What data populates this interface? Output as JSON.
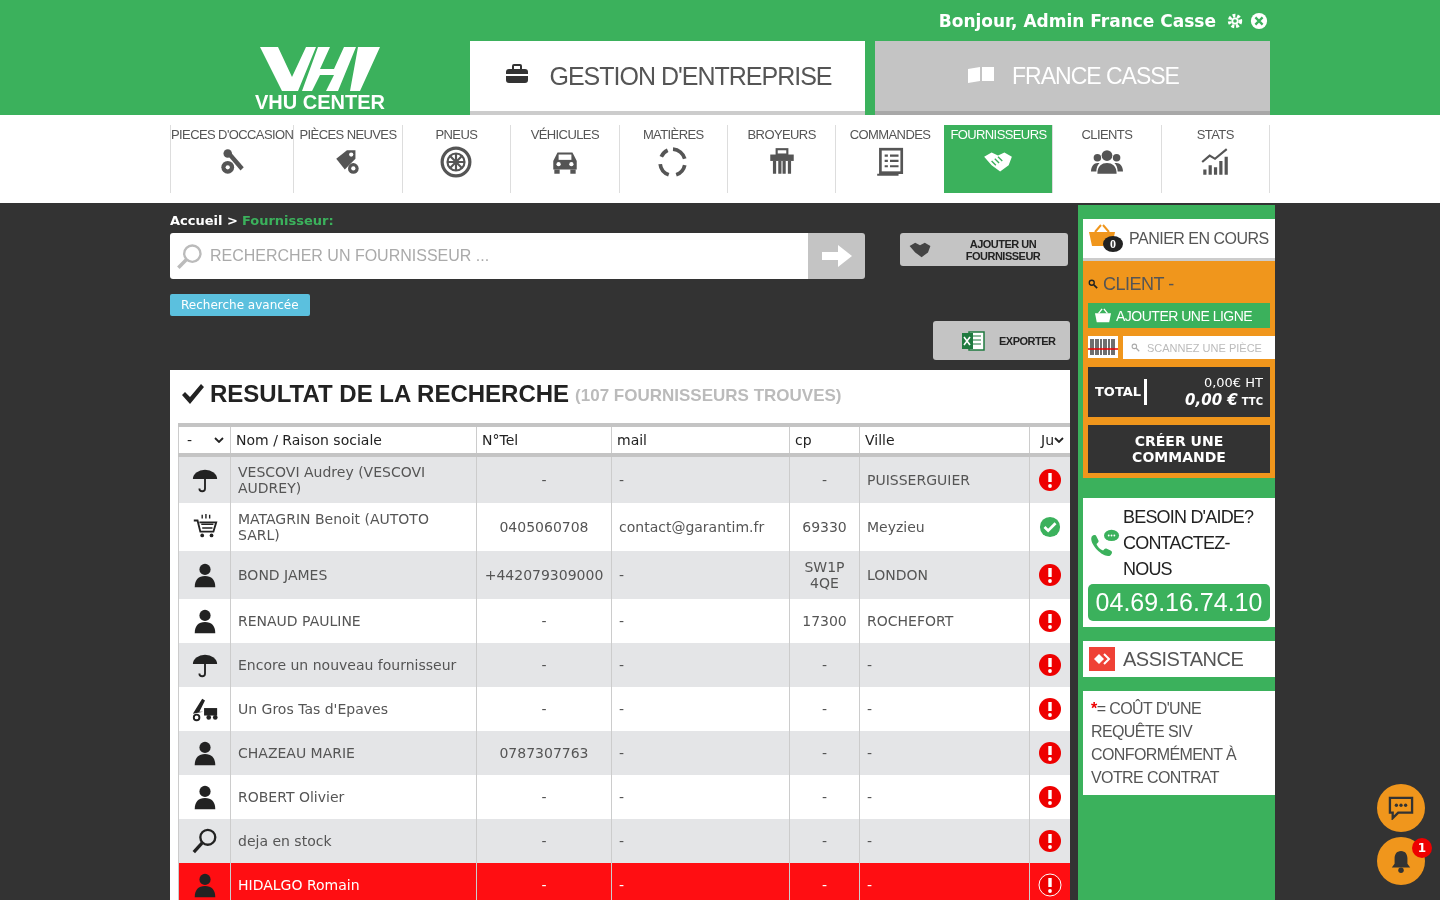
{
  "header": {
    "greeting": "Bonjour, Admin France Casse",
    "logo_text": "VHU CENTER",
    "top_tabs": [
      {
        "label": "GESTION D'ENTREPRISE",
        "selected": true
      },
      {
        "label": "FRANCE CASSE",
        "selected": false
      }
    ]
  },
  "nav": [
    {
      "label": "PIECES D'OCCASION",
      "selected": false
    },
    {
      "label": "PIÈCES NEUVES",
      "selected": false
    },
    {
      "label": "PNEUS",
      "selected": false
    },
    {
      "label": "VÉHICULES",
      "selected": false
    },
    {
      "label": "MATIÈRES",
      "selected": false
    },
    {
      "label": "BROYEURS",
      "selected": false
    },
    {
      "label": "COMMANDES",
      "selected": false
    },
    {
      "label": "FOURNISSEURS",
      "selected": true
    },
    {
      "label": "CLIENTS",
      "selected": false
    },
    {
      "label": "STATS",
      "selected": false
    }
  ],
  "breadcrumb": [
    {
      "text": "Accueil >"
    },
    {
      "text": "Fournisseur:"
    }
  ],
  "search": {
    "placeholder": "RECHERCHER UN FOURNISSEUR ..."
  },
  "add_button": "AJOUTER UN FOURNISSEUR",
  "advanced_search": "Recherche avancée",
  "export_button": "EXPORTER",
  "results": {
    "title": "RESULTAT DE LA RECHERCHE",
    "count": "(107 FOURNISSEURS TROUVES)"
  },
  "table": {
    "columns": [
      {
        "kind": "select",
        "label": "-"
      },
      {
        "kind": "text",
        "label": "Nom / Raison sociale"
      },
      {
        "kind": "text",
        "label": "N°Tel"
      },
      {
        "kind": "text",
        "label": "mail"
      },
      {
        "kind": "text",
        "label": "cp"
      },
      {
        "kind": "text",
        "label": "Ville"
      },
      {
        "kind": "select",
        "label": "Ju"
      }
    ],
    "rows": [
      {
        "kind": "umbrella",
        "name": "VESCOVI Audrey (VESCOVI AUDREY)",
        "tel": "-",
        "mail": "-",
        "cp": "-",
        "ville": "PUISSERGUIER",
        "ok": false,
        "highlighted": false
      },
      {
        "kind": "cart",
        "name": "MATAGRIN Benoit (AUTOTO SARL)",
        "tel": "0405060708",
        "mail": "contact@garantim.fr",
        "cp": "69330",
        "ville": "Meyzieu",
        "ok": true,
        "highlighted": false
      },
      {
        "kind": "person",
        "name": "BOND JAMES",
        "tel": "+442079309000",
        "mail": "-",
        "cp": "SW1P 4QE",
        "ville": "LONDON",
        "ok": false,
        "highlighted": false
      },
      {
        "kind": "person",
        "name": "RENAUD PAULINE",
        "tel": "-",
        "mail": "-",
        "cp": "17300",
        "ville": "ROCHEFORT",
        "ok": false,
        "highlighted": false
      },
      {
        "kind": "umbrella",
        "name": "Encore un nouveau fournisseur",
        "tel": "-",
        "mail": "-",
        "cp": "-",
        "ville": "-",
        "ok": false,
        "highlighted": false
      },
      {
        "kind": "truck",
        "name": "Un Gros Tas d'Epaves",
        "tel": "-",
        "mail": "-",
        "cp": "-",
        "ville": "-",
        "ok": false,
        "highlighted": false
      },
      {
        "kind": "person",
        "name": "CHAZEAU MARIE",
        "tel": "0787307763",
        "mail": "-",
        "cp": "-",
        "ville": "-",
        "ok": false,
        "highlighted": false
      },
      {
        "kind": "person",
        "name": "ROBERT Olivier",
        "tel": "-",
        "mail": "-",
        "cp": "-",
        "ville": "-",
        "ok": false,
        "highlighted": false
      },
      {
        "kind": "search",
        "name": "deja en stock",
        "tel": "-",
        "mail": "-",
        "cp": "-",
        "ville": "-",
        "ok": false,
        "highlighted": false
      },
      {
        "kind": "person",
        "name": "HIDALGO Romain",
        "tel": "-",
        "mail": "-",
        "cp": "-",
        "ville": "-",
        "ok": false,
        "highlighted": true
      }
    ]
  },
  "cart": {
    "title": "PANIER EN COURS",
    "badge": "0",
    "client": "CLIENT -",
    "add_line": "AJOUTER UNE LIGNE",
    "scan_placeholder": "SCANNEZ UNE PIÈCE",
    "total_label": "TOTAL",
    "total_ht": "0,00€ HT",
    "total_ttc": "0,00 €",
    "ttc_unit": "TTC",
    "create_button": "CRÉER UNE COMMANDE"
  },
  "help": {
    "title": "BESOIN D'AIDE? CONTACTEZ-NOUS",
    "phone": "04.69.16.74.10"
  },
  "assistance": "ASSISTANCE",
  "note": {
    "mark": "*",
    "text": "= COÛT D'UNE REQUÊTE SIV CONFORMÉMENT À VOTRE CONTRAT"
  },
  "notifications": {
    "count": "1"
  }
}
